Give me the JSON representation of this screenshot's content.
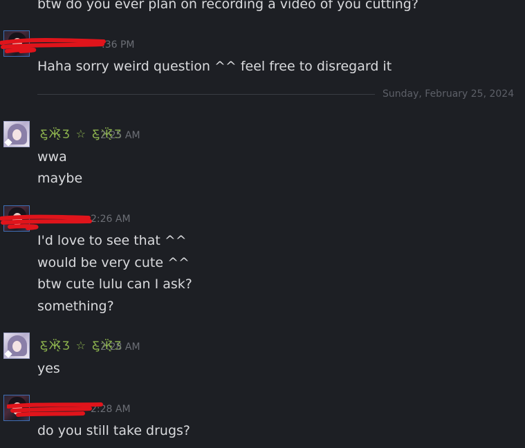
{
  "messages": {
    "top_partial": "btw do you ever plan on recording a video of you cutting?",
    "group1": {
      "time": ":36 PM",
      "lines": [
        "Haha sorry weird question ^^ feel free to disregard it"
      ]
    },
    "divider": "Sunday, February 25, 2024",
    "group2": {
      "username": "Ƹ̵̡Ӝ̵̨̄Ʒ ☆ Ƹ̵̡Ӝ̵̨̄Ʒ",
      "time": "2:25 AM",
      "lines": [
        "wwa",
        "maybe"
      ]
    },
    "group3": {
      "time": "2:26 AM",
      "lines": [
        "I'd love to see that ^^",
        "would be very cute ^^",
        "btw cute lulu can I ask?",
        "something?"
      ]
    },
    "group4": {
      "username": "Ƹ̵̡Ӝ̵̨̄Ʒ ☆ Ƹ̵̡Ӝ̵̨̄Ʒ",
      "time": "2:28 AM",
      "lines": [
        "yes"
      ]
    },
    "group5": {
      "time": "2:28 AM",
      "lines": [
        "do you still take drugs?"
      ]
    }
  },
  "colors": {
    "background": "#1d1f24",
    "text": "#d9dadd",
    "timestamp": "#6c6f76",
    "username_green": "#8fb64f",
    "redaction": "#e0141b"
  },
  "icons": {
    "avatar_dark": "anime-avatar-dark-hair",
    "avatar_light": "anime-avatar-purple-hair"
  }
}
